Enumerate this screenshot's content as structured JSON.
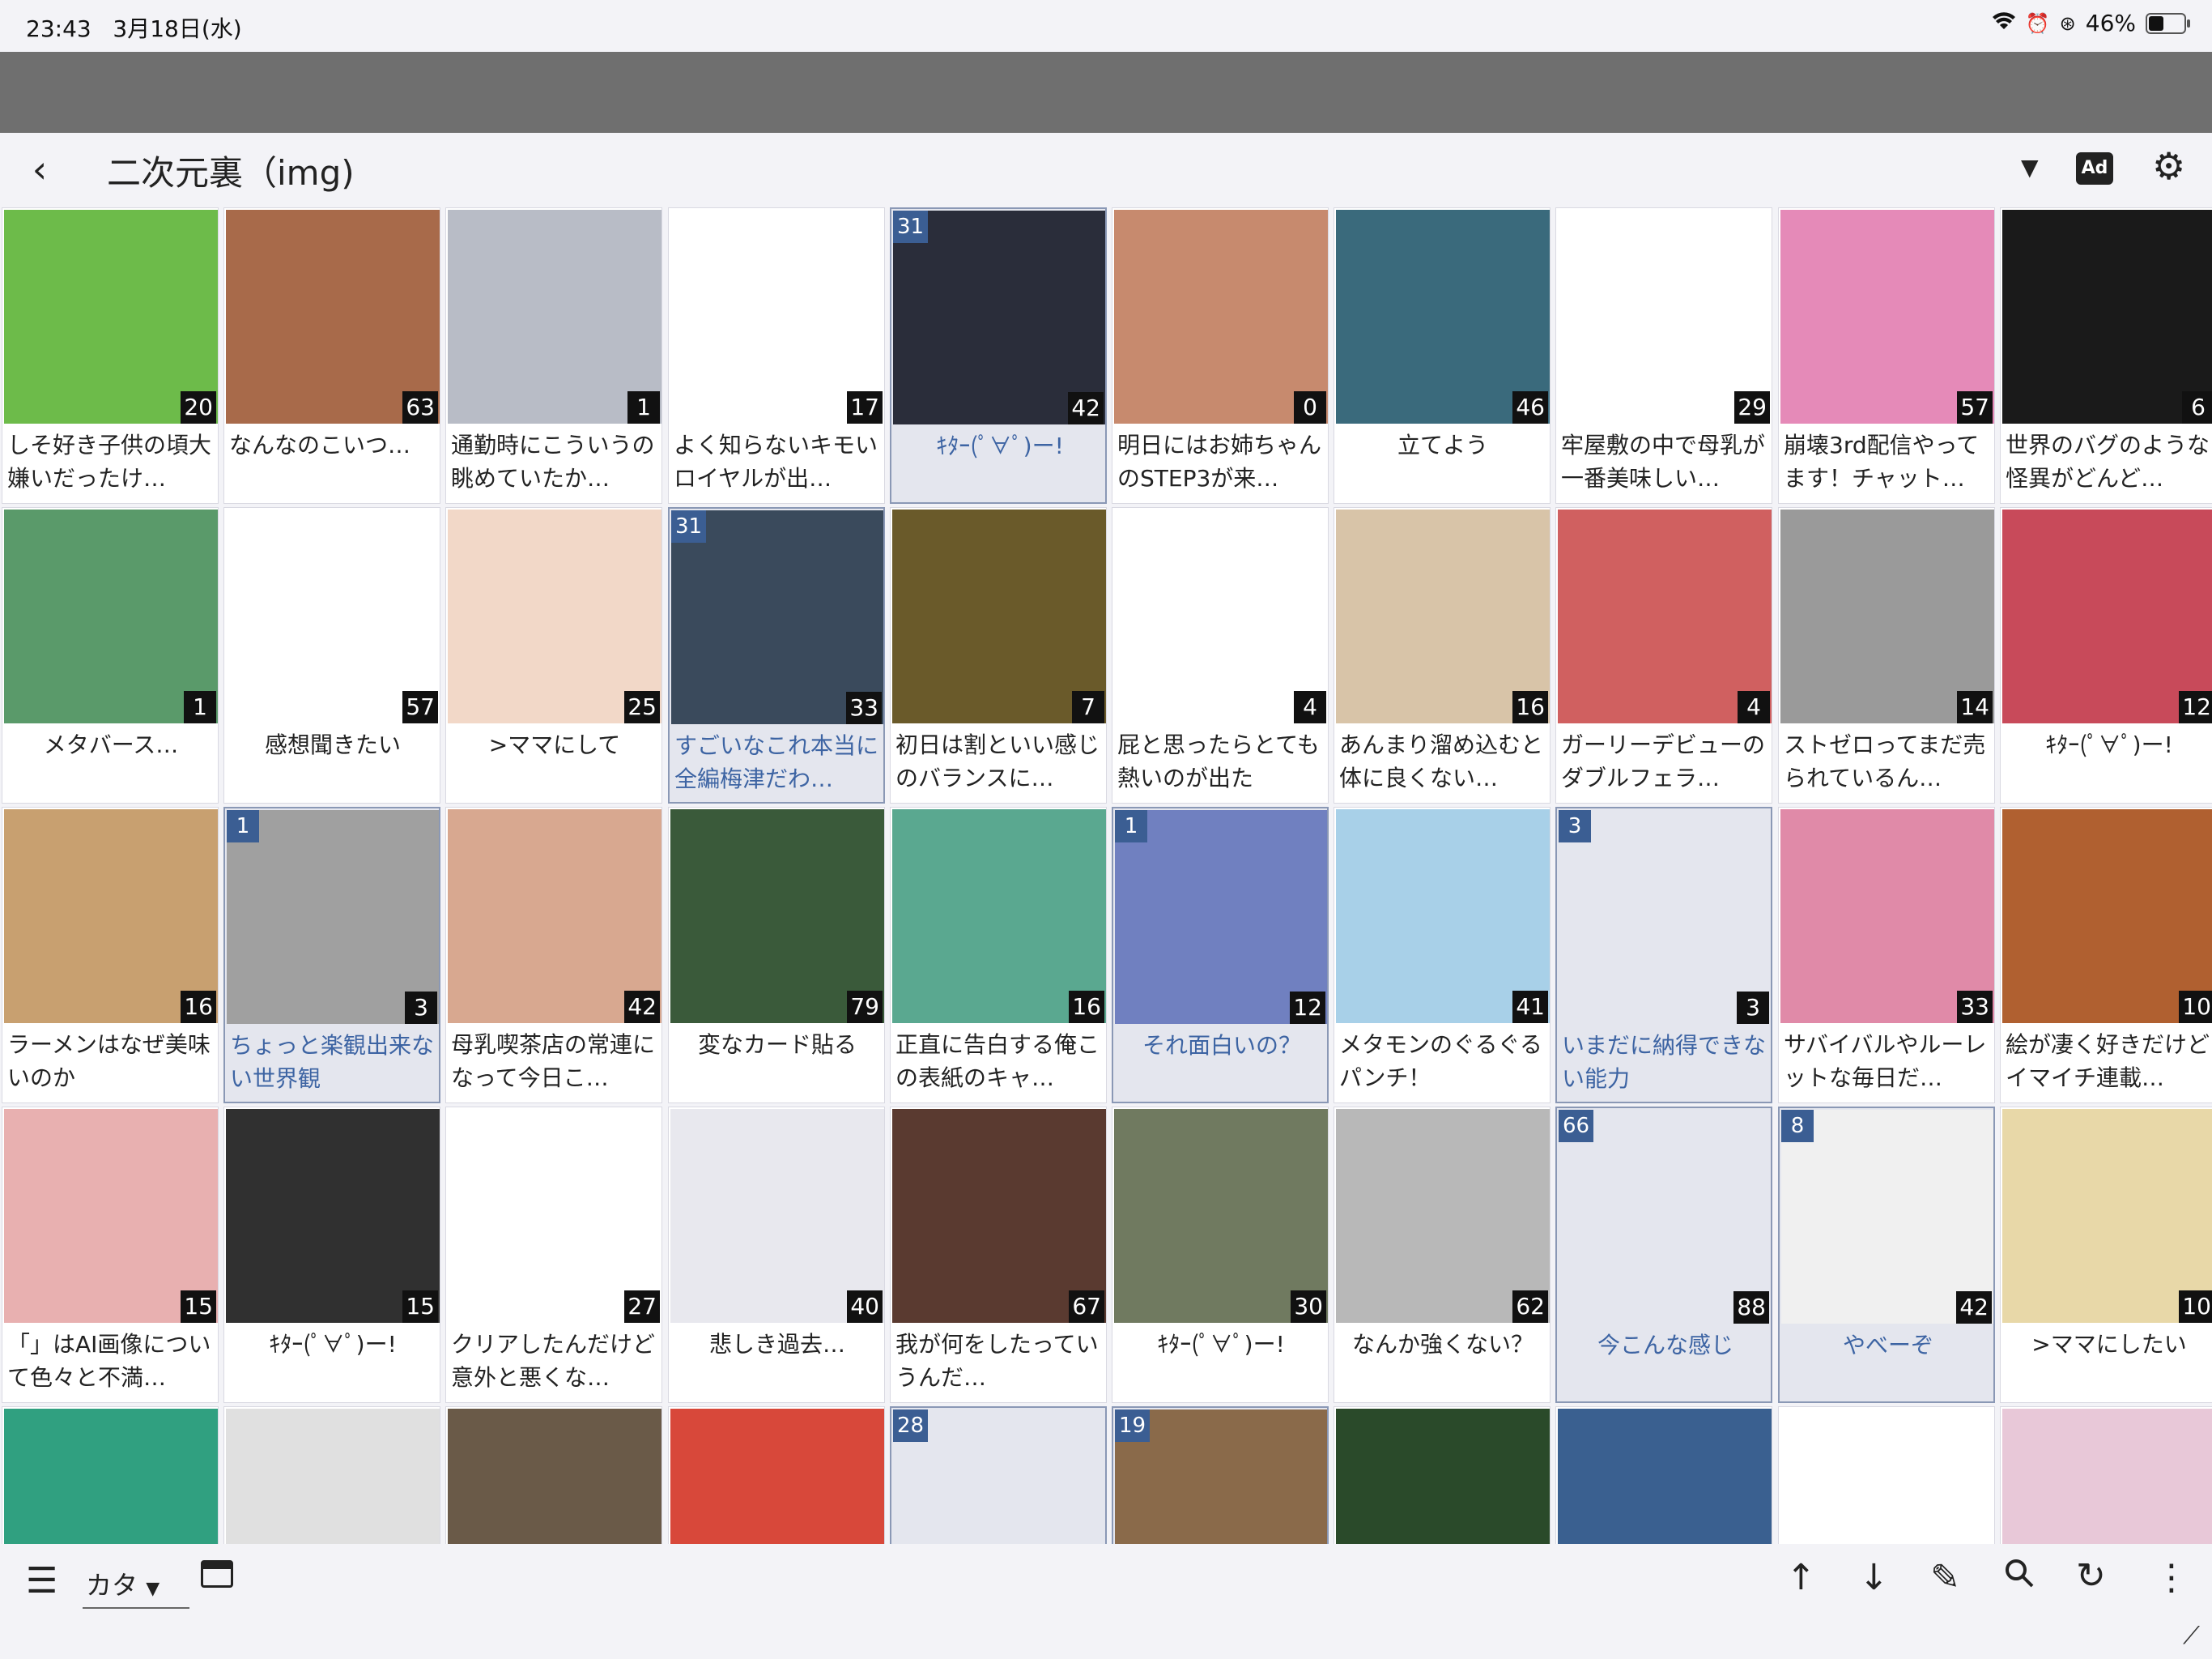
{
  "status_bar": {
    "time": "23:43",
    "date": "3月18日(水)",
    "battery_percent": "46%",
    "battery_level": 0.46
  },
  "header": {
    "back_icon": "back-arrow-icon",
    "title": "二次元裏（img)",
    "ad_label": "Ad",
    "settings_icon": "gear-icon"
  },
  "colors": {
    "highlight_bg": "#e4e6ee",
    "highlight_text": "#3d64a3",
    "badge": "#3b5e93",
    "gray_bar": "#6f6f6f"
  },
  "threads": [
    {
      "label": "しそ好き子供の頃大嫌いだったけ…",
      "count": "20",
      "badge": "",
      "highlight": false,
      "center": false,
      "thumb": "#6dbb4a"
    },
    {
      "label": "なんなのこいつ…",
      "count": "63",
      "badge": "",
      "highlight": false,
      "center": false,
      "thumb": "#a86a4a"
    },
    {
      "label": "通勤時にこういうの眺めていたか…",
      "count": "1",
      "badge": "",
      "highlight": false,
      "center": false,
      "thumb": "#b8bcc6"
    },
    {
      "label": "よく知らないキモいロイヤルが出…",
      "count": "17",
      "badge": "",
      "highlight": false,
      "center": false,
      "thumb": ""
    },
    {
      "label": "ｷﾀｰ(ﾟ∀ﾟ)ー!",
      "count": "42",
      "badge": "31",
      "highlight": true,
      "center": true,
      "thumb": "#2a2d3a"
    },
    {
      "label": "明日にはお姉ちゃんのSTEP3が来…",
      "count": "0",
      "badge": "",
      "highlight": false,
      "center": false,
      "thumb": "#c78a6e"
    },
    {
      "label": "立てよう",
      "count": "46",
      "badge": "",
      "highlight": false,
      "center": true,
      "thumb": "#3a6a7c"
    },
    {
      "label": "牢屋敷の中で母乳が一番美味しい…",
      "count": "29",
      "badge": "",
      "highlight": false,
      "center": false,
      "thumb": ""
    },
    {
      "label": "崩壊3rd配信やってます！チャット…",
      "count": "57",
      "badge": "",
      "highlight": false,
      "center": false,
      "thumb": "#e58ab8"
    },
    {
      "label": "世界のバグのような怪異がどんど…",
      "count": "6",
      "badge": "",
      "highlight": false,
      "center": false,
      "thumb": "#1a1a1a"
    },
    {
      "label": "メタバース…",
      "count": "1",
      "badge": "",
      "highlight": false,
      "center": true,
      "thumb": "#5a9a6a"
    },
    {
      "label": "感想聞きたい",
      "count": "57",
      "badge": "",
      "highlight": false,
      "center": true,
      "thumb": ""
    },
    {
      "label": ">ママにして",
      "count": "25",
      "badge": "",
      "highlight": false,
      "center": true,
      "thumb": "#f2d8c8"
    },
    {
      "label": "すごいなこれ本当に全編梅津だわ…",
      "count": "33",
      "badge": "31",
      "highlight": true,
      "center": false,
      "thumb": "#3a4a5c"
    },
    {
      "label": "初日は割といい感じのバランスに…",
      "count": "7",
      "badge": "",
      "highlight": false,
      "center": false,
      "thumb": "#6a5a2a"
    },
    {
      "label": "屁と思ったらとても熱いのが出た",
      "count": "4",
      "badge": "",
      "highlight": false,
      "center": false,
      "thumb": ""
    },
    {
      "label": "あんまり溜め込むと体に良くない…",
      "count": "16",
      "badge": "",
      "highlight": false,
      "center": false,
      "thumb": "#d8c4a8"
    },
    {
      "label": "ガーリーデビューのダブルフェラ…",
      "count": "4",
      "badge": "",
      "highlight": false,
      "center": false,
      "thumb": "#d06060"
    },
    {
      "label": "ストゼロってまだ売られているん…",
      "count": "14",
      "badge": "",
      "highlight": false,
      "center": false,
      "thumb": "#9a9a9a"
    },
    {
      "label": "ｷﾀｰ(ﾟ∀ﾟ)ー!",
      "count": "12",
      "badge": "",
      "highlight": false,
      "center": true,
      "thumb": "#c84a5a"
    },
    {
      "label": "ラーメンはなぜ美味いのか",
      "count": "16",
      "badge": "",
      "highlight": false,
      "center": false,
      "thumb": "#c8a070"
    },
    {
      "label": "ちょっと楽観出来ない世界観",
      "count": "3",
      "badge": "1",
      "highlight": true,
      "center": false,
      "thumb": "#a0a0a0"
    },
    {
      "label": "母乳喫茶店の常連になって今日こ…",
      "count": "42",
      "badge": "",
      "highlight": false,
      "center": false,
      "thumb": "#d8a890"
    },
    {
      "label": "変なカード貼る",
      "count": "79",
      "badge": "",
      "highlight": false,
      "center": true,
      "thumb": "#3a5a3a"
    },
    {
      "label": "正直に告白する俺この表紙のキャ…",
      "count": "16",
      "badge": "",
      "highlight": false,
      "center": false,
      "thumb": "#5aa890"
    },
    {
      "label": "それ面白いの？",
      "count": "12",
      "badge": "1",
      "highlight": true,
      "center": true,
      "thumb": "#7080c0"
    },
    {
      "label": "メタモンのぐるぐるパンチ！",
      "count": "41",
      "badge": "",
      "highlight": false,
      "center": false,
      "thumb": "#a8d0e8"
    },
    {
      "label": "いまだに納得できない能力",
      "count": "3",
      "badge": "3",
      "highlight": true,
      "center": false,
      "thumb": ""
    },
    {
      "label": "サバイバルやルーレットな毎日だ…",
      "count": "33",
      "badge": "",
      "highlight": false,
      "center": false,
      "thumb": "#e08aa8"
    },
    {
      "label": "絵が凄く好きだけどイマイチ連載…",
      "count": "10",
      "badge": "",
      "highlight": false,
      "center": false,
      "thumb": "#b06030"
    },
    {
      "label": "「」はAI画像について色々と不満…",
      "count": "15",
      "badge": "",
      "highlight": false,
      "center": false,
      "thumb": "#e8b0b0"
    },
    {
      "label": "ｷﾀｰ(ﾟ∀ﾟ)ー!",
      "count": "15",
      "badge": "",
      "highlight": false,
      "center": true,
      "thumb": "#303030"
    },
    {
      "label": "クリアしたんだけど意外と悪くな…",
      "count": "27",
      "badge": "",
      "highlight": false,
      "center": false,
      "thumb": ""
    },
    {
      "label": "悲しき過去…",
      "count": "40",
      "badge": "",
      "highlight": false,
      "center": true,
      "thumb": "#e8e8ee"
    },
    {
      "label": "我が何をしたっていうんだ…",
      "count": "67",
      "badge": "",
      "highlight": false,
      "center": false,
      "thumb": "#5a3a30"
    },
    {
      "label": "ｷﾀｰ(ﾟ∀ﾟ)ー!",
      "count": "30",
      "badge": "",
      "highlight": false,
      "center": true,
      "thumb": "#707a60"
    },
    {
      "label": "なんか強くない？",
      "count": "62",
      "badge": "",
      "highlight": false,
      "center": true,
      "thumb": "#b8b8b8"
    },
    {
      "label": "今こんな感じ",
      "count": "88",
      "badge": "66",
      "highlight": true,
      "center": true,
      "thumb": ""
    },
    {
      "label": "やべーぞ",
      "count": "42",
      "badge": "8",
      "highlight": true,
      "center": true,
      "thumb": "#f0f0f0"
    },
    {
      "label": ">ママにしたい",
      "count": "10",
      "badge": "",
      "highlight": false,
      "center": true,
      "thumb": "#e8d8a8"
    },
    {
      "label": "",
      "count": "",
      "badge": "",
      "highlight": false,
      "center": false,
      "thumb": "#30a080"
    },
    {
      "label": "",
      "count": "",
      "badge": "",
      "highlight": false,
      "center": false,
      "thumb": "#e0e0e0"
    },
    {
      "label": "",
      "count": "",
      "badge": "",
      "highlight": false,
      "center": false,
      "thumb": "#6a5a48"
    },
    {
      "label": "",
      "count": "",
      "badge": "",
      "highlight": false,
      "center": false,
      "thumb": "#d8483a"
    },
    {
      "label": "",
      "count": "",
      "badge": "28",
      "highlight": true,
      "center": false,
      "thumb": ""
    },
    {
      "label": "",
      "count": "",
      "badge": "19",
      "highlight": true,
      "center": false,
      "thumb": "#8a6a4a"
    },
    {
      "label": "",
      "count": "",
      "badge": "",
      "highlight": false,
      "center": false,
      "thumb": "#2a4a2a"
    },
    {
      "label": "",
      "count": "",
      "badge": "",
      "highlight": false,
      "center": false,
      "thumb": "#3a6090"
    },
    {
      "label": "",
      "count": "",
      "badge": "",
      "highlight": false,
      "center": false,
      "thumb": ""
    },
    {
      "label": "",
      "count": "",
      "badge": "",
      "highlight": false,
      "center": false,
      "thumb": "#e8c8d8"
    }
  ],
  "bottom_bar": {
    "menu_icon": "hamburger-menu-icon",
    "select_value": "カタ",
    "window_icon": "window-icon",
    "up_icon": "arrow-up-icon",
    "down_icon": "arrow-down-icon",
    "edit_icon": "pencil-icon",
    "search_icon": "search-icon",
    "refresh_icon": "refresh-icon",
    "more_icon": "more-vert-icon"
  }
}
